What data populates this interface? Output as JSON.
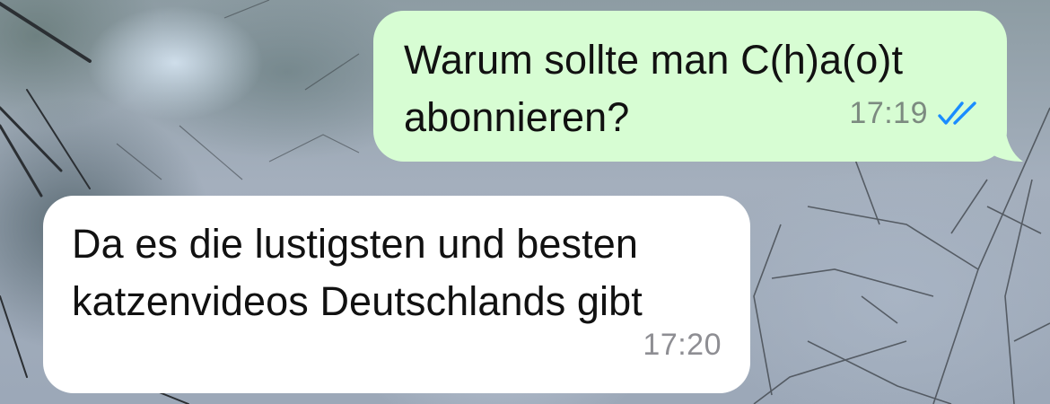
{
  "chat": {
    "messages": [
      {
        "direction": "outgoing",
        "text": "Warum sollte man C(h)a(o)t\nabonnieren?",
        "time": "17:19",
        "status_icon": "double-check-read-icon",
        "bubble_color": "#d7fdd3",
        "status_color": "#1a8cff"
      },
      {
        "direction": "incoming",
        "text": "Da es die lustigsten und besten\nkatzenvideos Deutschlands gibt",
        "time": "17:20",
        "bubble_color": "#ffffff"
      }
    ]
  }
}
